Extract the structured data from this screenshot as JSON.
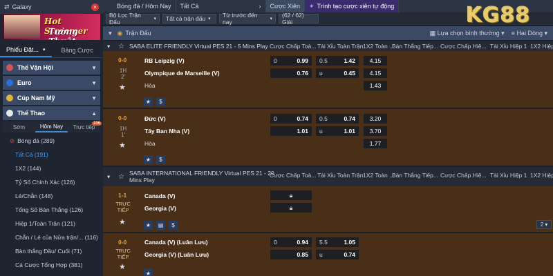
{
  "sidebar": {
    "sport_label": "Galaxy",
    "banner_line1": "Hot Streamer",
    "banner_line2": "Tường Thuật",
    "tabs": [
      "Phiếu Đặt...",
      "Bảng Cược"
    ],
    "categories": [
      {
        "label": "Thế Vận Hội",
        "chev": "▼"
      },
      {
        "label": "Euro",
        "chev": "▼"
      },
      {
        "label": "Cúp Nam Mỹ",
        "chev": "▼"
      },
      {
        "label": "Thể Thao",
        "chev": "▲"
      }
    ],
    "sub_tabs": {
      "early": "Sớm",
      "today": "Hôm Nay",
      "live": "Trực tiếp",
      "live_count": "106"
    },
    "menu": [
      {
        "label": "Bóng đá (289)"
      },
      {
        "label": "Tất Cả (191)"
      },
      {
        "label": "1X2 (144)"
      },
      {
        "label": "Tỷ Số Chính Xác (126)"
      },
      {
        "label": "Lẻ/Chẵn (148)"
      },
      {
        "label": "Tổng Số Bàn Thắng (126)"
      },
      {
        "label": "Hiệp 1/Toàn Trận (121)"
      },
      {
        "label": "Chẵn / Lẻ của Nửa trận/... (116)"
      },
      {
        "label": "Bàn thắng Đầu/ Cuối (71)"
      },
      {
        "label": "Cá Cược Tổng Hợp (381)"
      }
    ]
  },
  "topbar": {
    "title": "Bóng đá / Hôm Nay",
    "all": "Tất Cả",
    "parlay": "Cược Xiên",
    "builder": "Trình tạo cược xiên tự động"
  },
  "filters": {
    "league_filter": "Bộ Lọc Trận Đấu",
    "all_matches": "Tất cả trận đấu",
    "sort": "Từ trước đến nay",
    "count": "(62 / 62) Giải"
  },
  "sport_header": {
    "label": "Trận Đấu",
    "view": "Lựa chọn bình thường",
    "lines": "Hai Dòng"
  },
  "columns": [
    "Cược Chấp Toà...",
    "Tài Xỉu Toàn Trận",
    "1X2 Toàn ...",
    "Bàn Thắng Tiếp...",
    "Cược Chấp Hiệ...",
    "Tài Xỉu Hiệp 1",
    "1X2 Hiệp 1"
  ],
  "leagues": [
    {
      "name": "SABA ELITE FRIENDLY Virtual PES 21 - 5 Mins Play",
      "matches": [
        {
          "score": "0-0",
          "half": "1H",
          "minute": "2'",
          "home": "RB Leipzig (V)",
          "away": "Olympique de Marseille (V)",
          "draw": "Hòa",
          "hdp": [
            {
              "k": "0",
              "v": "0.99"
            },
            {
              "k": "",
              "v": "0.76"
            }
          ],
          "ou": [
            {
              "k": "0.5",
              "v": "1.42"
            },
            {
              "k": "u",
              "v": "0.45"
            }
          ],
          "x12": [
            "4.15",
            "4.15",
            "1.43"
          ]
        },
        {
          "score": "0-0",
          "half": "1H",
          "minute": "1'",
          "home": "Đức (V)",
          "away": "Tây Ban Nha (V)",
          "draw": "Hòa",
          "hdp": [
            {
              "k": "0",
              "v": "0.74"
            },
            {
              "k": "",
              "v": "1.01"
            }
          ],
          "ou": [
            {
              "k": "0.5",
              "v": "0.74"
            },
            {
              "k": "u",
              "v": "1.01"
            }
          ],
          "x12": [
            "3.20",
            "3.70",
            "1.77"
          ]
        }
      ]
    },
    {
      "name": "SABA INTERNATIONAL FRIENDLY Virtual PES 21 - 20 Mins Play",
      "matches": [
        {
          "score": "1-1",
          "live": "TRỰC TIẾP",
          "home": "Canada (V)",
          "away": "Georgia (V)",
          "page": "2"
        },
        {
          "score": "0-0",
          "live": "TRỰC TIẾP",
          "home": "Canada (V) (Luân Lưu)",
          "away": "Georgia (V) (Luân Lưu)",
          "hdp": [
            {
              "k": "0",
              "v": "0.94"
            },
            {
              "k": "",
              "v": "0.85"
            }
          ],
          "ou": [
            {
              "k": "5.5",
              "v": "1.05"
            },
            {
              "k": "u",
              "v": "0.74"
            }
          ]
        }
      ]
    }
  ],
  "logo": "KG88"
}
